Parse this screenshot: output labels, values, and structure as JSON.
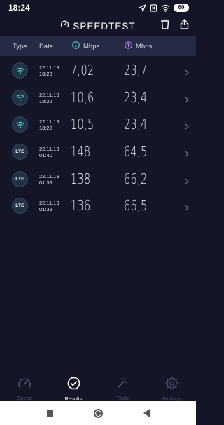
{
  "status_bar": {
    "time": "18:24",
    "battery": "60",
    "icons": [
      "location-arrow-icon",
      "sim-off-icon",
      "wifi-icon",
      "battery-icon"
    ]
  },
  "header": {
    "title": "SPEEDTEST",
    "icons": [
      "speedometer-icon",
      "trash-icon",
      "share-icon"
    ]
  },
  "columns": {
    "type": "Type",
    "date": "Date",
    "download": "Mbps",
    "upload": "Mbps"
  },
  "results": [
    {
      "type": "wifi",
      "type_label": "",
      "date": "22.11.19",
      "time": "18:23",
      "download": "7,02",
      "upload": "23,7"
    },
    {
      "type": "wifi",
      "type_label": "",
      "date": "22.11.19",
      "time": "18:22",
      "download": "10,6",
      "upload": "23,4"
    },
    {
      "type": "wifi",
      "type_label": "",
      "date": "22.11.19",
      "time": "18:22",
      "download": "10,5",
      "upload": "23,4"
    },
    {
      "type": "lte",
      "type_label": "LTE",
      "date": "22.11.19",
      "time": "01:40",
      "download": "148",
      "upload": "64,5"
    },
    {
      "type": "lte",
      "type_label": "LTE",
      "date": "22.11.19",
      "time": "01:39",
      "download": "138",
      "upload": "66,2"
    },
    {
      "type": "lte",
      "type_label": "LTE",
      "date": "22.11.19",
      "time": "01:38",
      "download": "136",
      "upload": "66,5"
    }
  ],
  "tabs": [
    {
      "label": "Speed",
      "icon": "speedometer-icon",
      "active": false
    },
    {
      "label": "Results",
      "icon": "check-circle-icon",
      "active": true
    },
    {
      "label": "Tools",
      "icon": "magic-wand-icon",
      "active": false
    },
    {
      "label": "Settings",
      "icon": "gear-icon",
      "active": false
    }
  ],
  "colors": {
    "background": "#141526",
    "header_strip": "#262a44",
    "download_accent": "#4fd1c5",
    "upload_accent": "#b37feb",
    "inactive_tab": "#4e536e"
  }
}
